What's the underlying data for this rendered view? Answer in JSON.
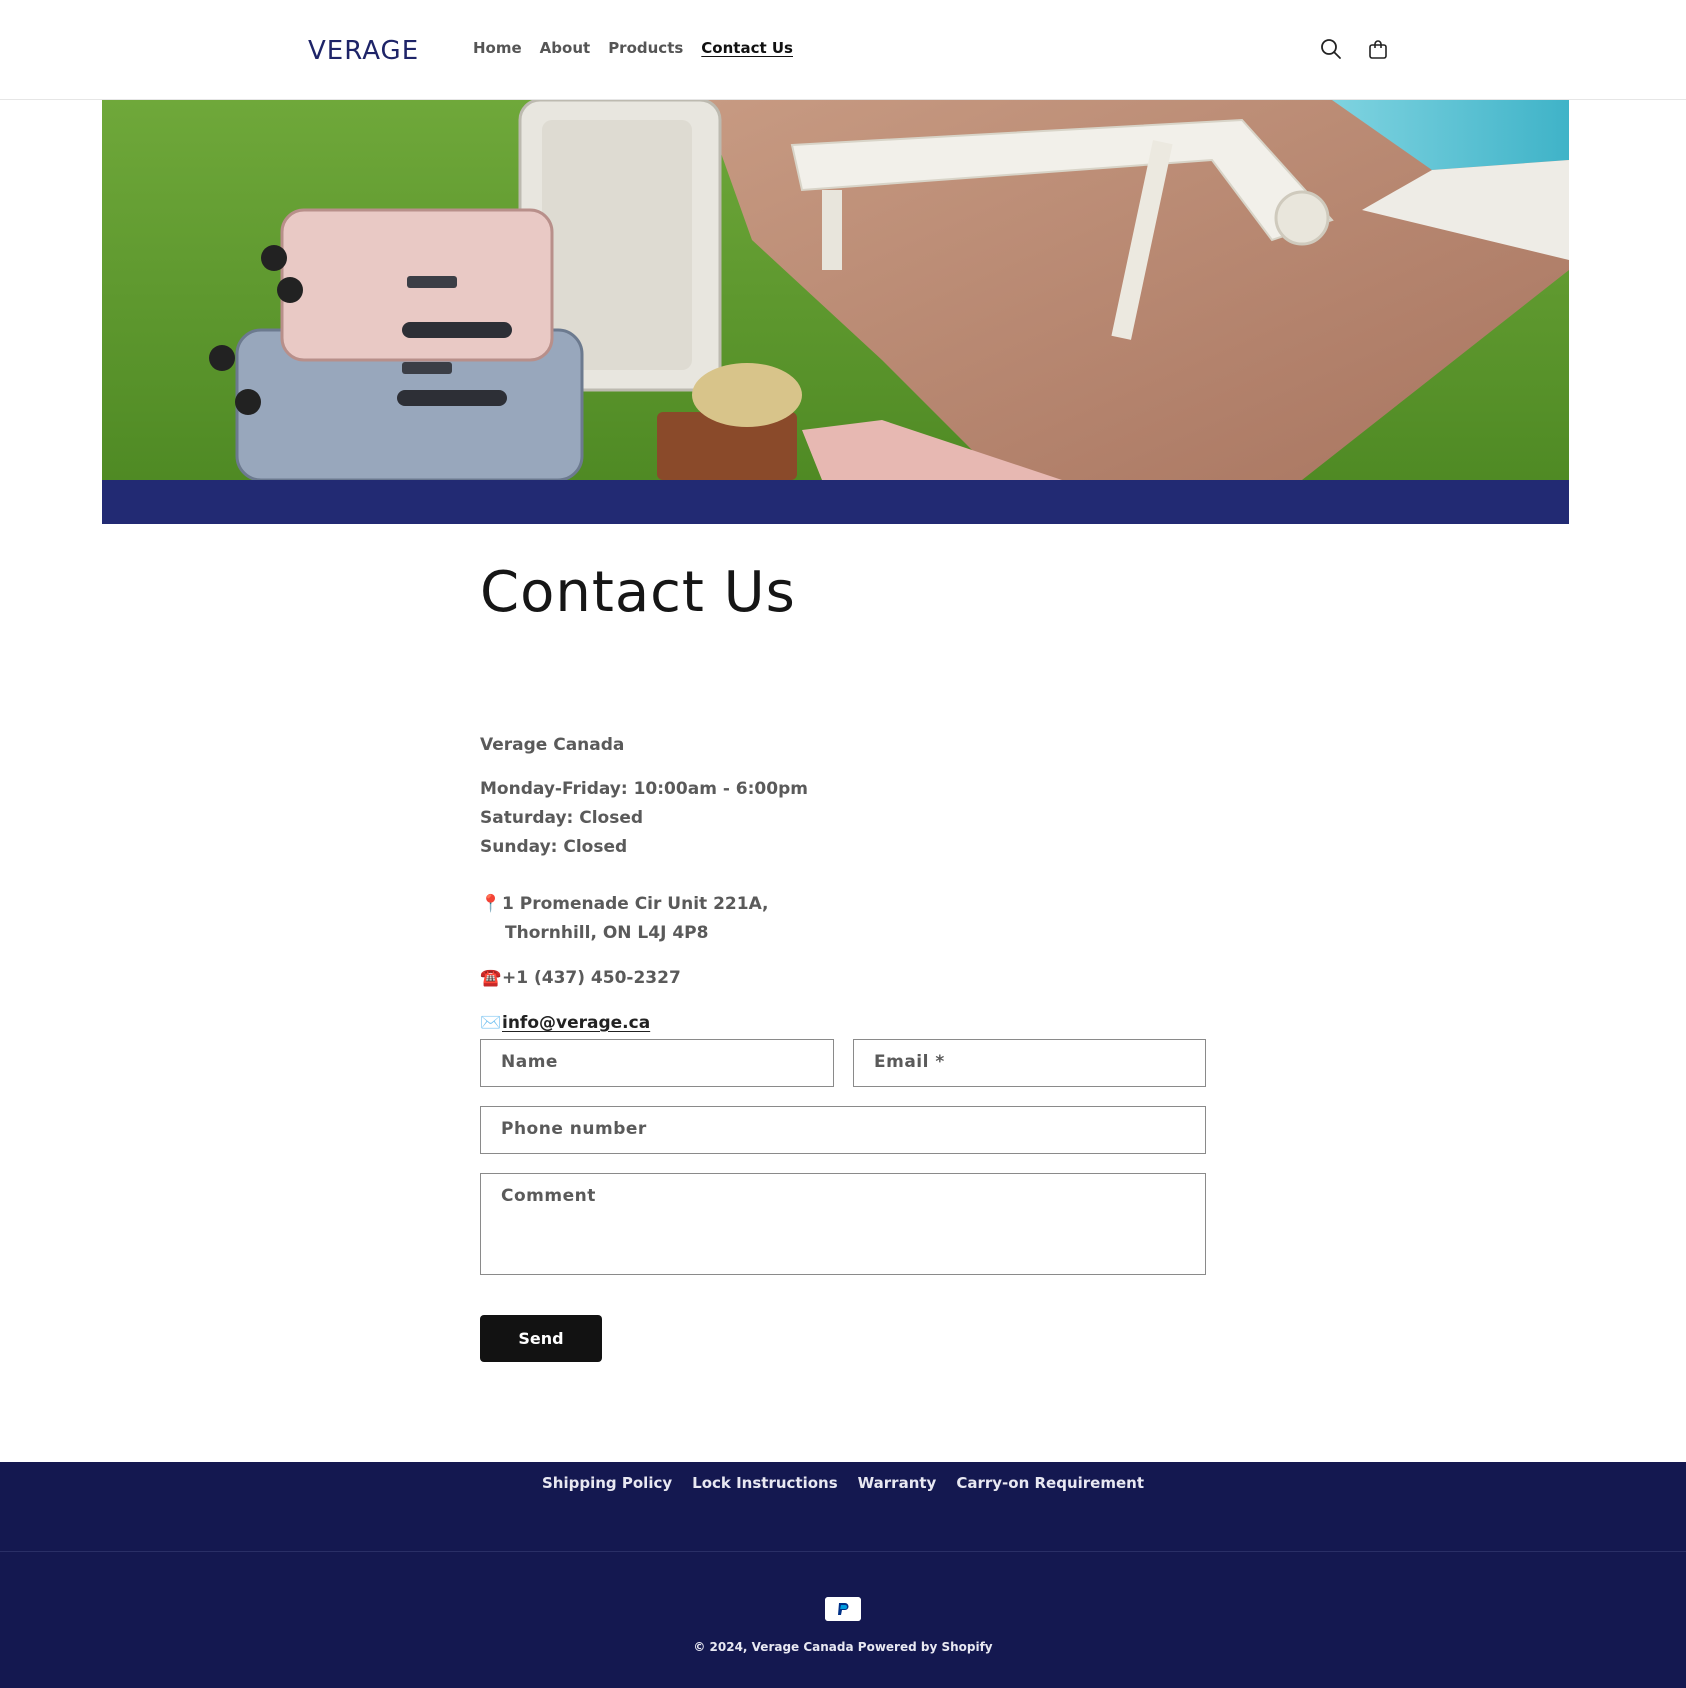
{
  "header": {
    "logo": "VERAGE",
    "nav": [
      "Home",
      "About",
      "Products",
      "Contact Us"
    ],
    "active_nav": "Contact Us",
    "icons": [
      "search-icon",
      "cart-icon"
    ]
  },
  "hero": {
    "image": "luggage-on-lawn-photo",
    "band_color": "#222a73"
  },
  "main": {
    "title": "Contact Us",
    "company": "Verage Canada",
    "hours": [
      "Monday-Friday: 10:00am - 6:00pm",
      "Saturday:  Closed",
      "Sunday: Closed"
    ],
    "address_emoji": "📍",
    "address": [
      "1 Promenade Cir Unit 221A,",
      "Thornhill, ON L4J 4P8"
    ],
    "phone_emoji": "☎️",
    "phone": "+1 (437) 450-2327",
    "email_emoji": "✉️",
    "email": "info@verage.ca"
  },
  "form": {
    "name_placeholder": "Name",
    "email_placeholder": "Email *",
    "phone_placeholder": "Phone number",
    "comment_placeholder": "Comment",
    "send_label": "Send"
  },
  "footer": {
    "links": [
      "Shipping Policy",
      "Lock Instructions",
      "Warranty",
      "Carry-on Requirement"
    ],
    "payment_icon": "paypal-icon",
    "copyright": "© 2024, Verage Canada Powered by Shopify"
  },
  "colors": {
    "brand": "#1e2468",
    "footer_bg": "#141850",
    "button_bg": "#121212"
  }
}
